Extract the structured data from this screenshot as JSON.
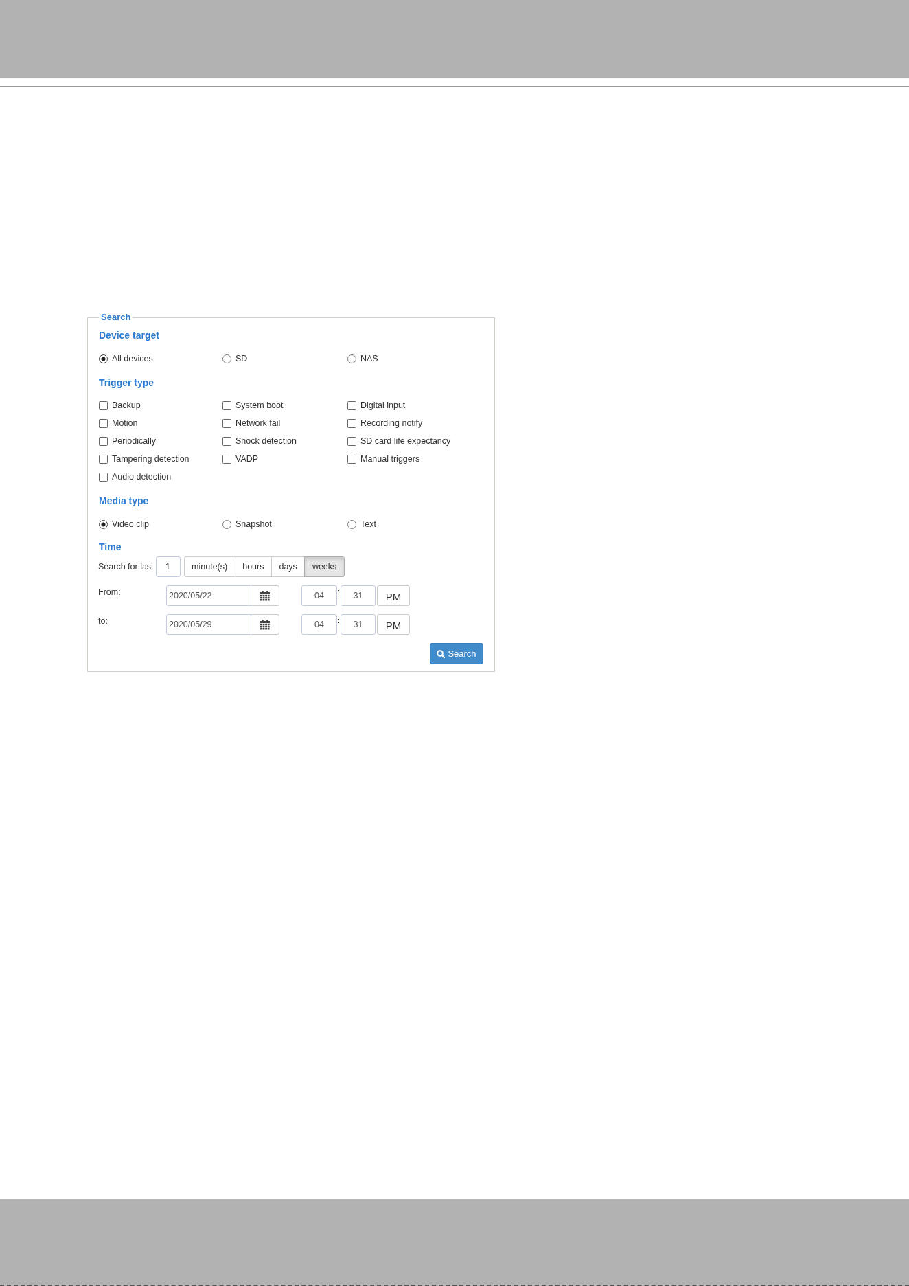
{
  "search_panel": {
    "title": "Search",
    "device_target": {
      "heading": "Device target",
      "options": [
        {
          "label": "All devices",
          "selected": true
        },
        {
          "label": "SD",
          "selected": false
        },
        {
          "label": "NAS",
          "selected": false
        }
      ]
    },
    "trigger_type": {
      "heading": "Trigger type",
      "options": [
        {
          "label": "Backup",
          "checked": false
        },
        {
          "label": "System boot",
          "checked": false
        },
        {
          "label": "Digital input",
          "checked": false
        },
        {
          "label": "Motion",
          "checked": false
        },
        {
          "label": "Network fail",
          "checked": false
        },
        {
          "label": "Recording notify",
          "checked": false
        },
        {
          "label": "Periodically",
          "checked": false
        },
        {
          "label": "Shock detection",
          "checked": false
        },
        {
          "label": "SD card life expectancy",
          "checked": false
        },
        {
          "label": "Tampering detection",
          "checked": false
        },
        {
          "label": "VADP",
          "checked": false
        },
        {
          "label": "Manual triggers",
          "checked": false
        },
        {
          "label": "Audio detection",
          "checked": false
        }
      ]
    },
    "media_type": {
      "heading": "Media type",
      "options": [
        {
          "label": "Video clip",
          "selected": true
        },
        {
          "label": "Snapshot",
          "selected": false
        },
        {
          "label": "Text",
          "selected": false
        }
      ]
    },
    "time": {
      "heading": "Time",
      "search_for_last": {
        "label": "Search for last",
        "value": "1",
        "units": [
          {
            "label": "minute(s)",
            "selected": false
          },
          {
            "label": "hours",
            "selected": false
          },
          {
            "label": "days",
            "selected": false
          },
          {
            "label": "weeks",
            "selected": true
          }
        ]
      },
      "ranges": [
        {
          "label": "From:",
          "date": "2020/05/22",
          "hour": "04",
          "separator": ":",
          "minute": "31",
          "period": "PM"
        },
        {
          "label": "to:",
          "date": "2020/05/29",
          "hour": "04",
          "separator": ":",
          "minute": "31",
          "period": "PM"
        }
      ]
    },
    "search_button": {
      "label": "Search"
    }
  }
}
